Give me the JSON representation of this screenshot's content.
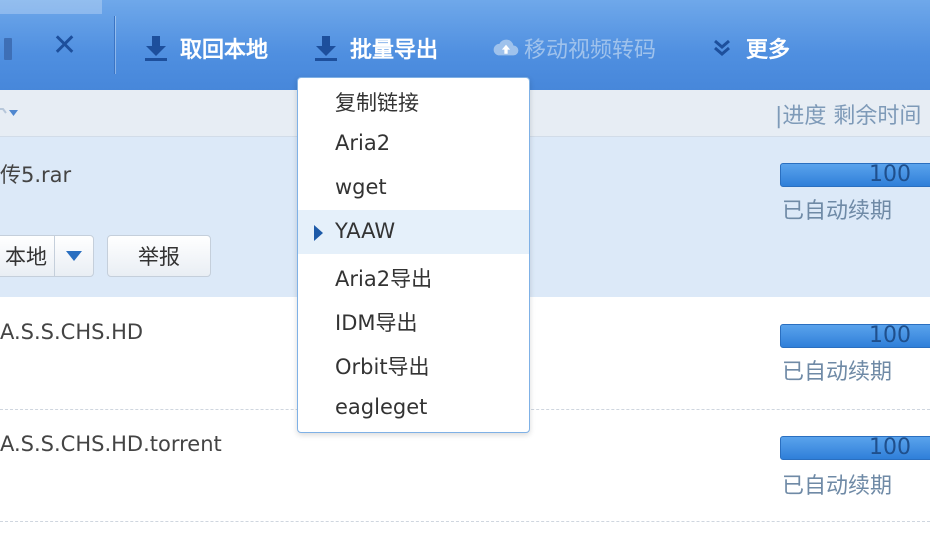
{
  "toolbar": {
    "close_icon": "close-icon",
    "fetch_local_label": "取回本地",
    "batch_export_label": "批量导出",
    "transcode_label": "移动视频转码",
    "more_label": "更多"
  },
  "columns": {
    "progress_remaining": "|进度 剩余时间"
  },
  "rows": [
    {
      "name": "传5.rar",
      "progress": "100",
      "status": "已自动续期"
    },
    {
      "name": "A.S.S.CHS.HD",
      "progress": "100",
      "status": "已自动续期"
    },
    {
      "name": "A.S.S.CHS.HD.torrent",
      "progress": "100",
      "status": "已自动续期"
    }
  ],
  "row_buttons": {
    "fetch_local": "本地",
    "report": "举报"
  },
  "dropdown": {
    "items": [
      {
        "label": "复制链接"
      },
      {
        "label": "Aria2"
      },
      {
        "label": "wget"
      },
      {
        "label": "YAAW"
      },
      {
        "label": "Aria2导出"
      },
      {
        "label": "IDM导出"
      },
      {
        "label": "Orbit导出"
      },
      {
        "label": "eagleget"
      }
    ],
    "selected_index": 3
  },
  "colors": {
    "toolbar_blue": "#4f8fe0",
    "selected_row": "#dce9f8",
    "progress_blue": "#2f7fd9"
  }
}
